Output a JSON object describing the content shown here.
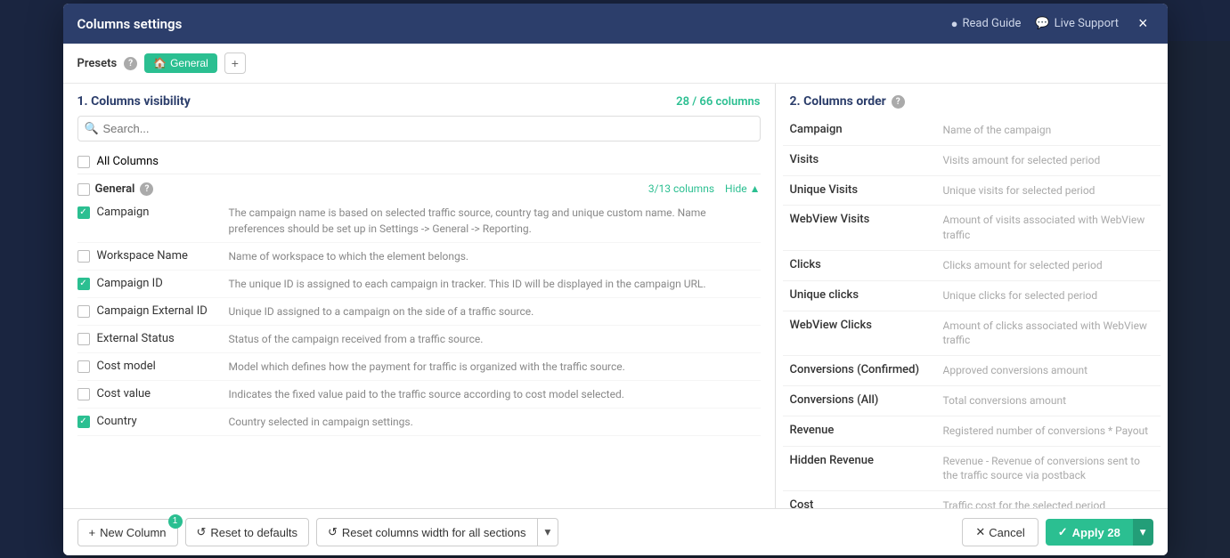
{
  "modal": {
    "title": "Columns settings",
    "close_label": "×"
  },
  "header_links": {
    "read_guide": "Read Guide",
    "live_support": "Live Support"
  },
  "presets": {
    "label": "Presets",
    "active": "General",
    "add_title": "+"
  },
  "left_panel": {
    "section_title": "1. Columns visibility",
    "columns_count": "28 / 66 columns",
    "search_placeholder": "Search...",
    "all_columns_label": "All Columns",
    "group": {
      "name": "General",
      "count": "3/13 columns",
      "hide_label": "Hide ▲"
    },
    "items": [
      {
        "label": "Campaign",
        "checked": true,
        "desc": "The campaign name is based on selected traffic source, country tag and unique custom name. Name preferences should be set up in Settings -> General -> Reporting."
      },
      {
        "label": "Workspace Name",
        "checked": false,
        "desc": "Name of workspace to which the element belongs."
      },
      {
        "label": "Campaign ID",
        "checked": true,
        "desc": "The unique ID is assigned to each campaign in tracker. This ID will be displayed in the campaign URL."
      },
      {
        "label": "Campaign External ID",
        "checked": false,
        "desc": "Unique ID assigned to a campaign on the side of a traffic source."
      },
      {
        "label": "External Status",
        "checked": false,
        "desc": "Status of the campaign received from a traffic source."
      },
      {
        "label": "Cost model",
        "checked": false,
        "desc": "Model which defines how the payment for traffic is organized with the traffic source."
      },
      {
        "label": "Cost value",
        "checked": false,
        "desc": "Indicates the fixed value paid to the traffic source according to cost model selected."
      },
      {
        "label": "Country",
        "checked": true,
        "desc": "Country selected in campaign settings."
      }
    ]
  },
  "right_panel": {
    "section_title": "2. Columns order",
    "items": [
      {
        "name": "Campaign",
        "desc": "Name of the campaign"
      },
      {
        "name": "Visits",
        "desc": "Visits amount for selected period"
      },
      {
        "name": "Unique Visits",
        "desc": "Unique visits for selected period"
      },
      {
        "name": "WebView Visits",
        "desc": "Amount of visits associated with WebView traffic"
      },
      {
        "name": "Clicks",
        "desc": "Clicks amount for selected period"
      },
      {
        "name": "Unique clicks",
        "desc": "Unique clicks for selected period"
      },
      {
        "name": "WebView Clicks",
        "desc": "Amount of clicks associated with WebView traffic"
      },
      {
        "name": "Conversions (Confirmed)",
        "desc": "Approved conversions amount"
      },
      {
        "name": "Conversions (All)",
        "desc": "Total conversions amount"
      },
      {
        "name": "Revenue",
        "desc": "Registered number of conversions * Payout"
      },
      {
        "name": "Hidden Revenue",
        "desc": "Revenue - Revenue of conversions sent to the traffic source via postback"
      },
      {
        "name": "Cost",
        "desc": "Traffic cost for the selected period"
      }
    ]
  },
  "footer": {
    "new_column_label": "New Column",
    "new_column_badge": "1",
    "reset_defaults_label": "Reset to defaults",
    "reset_width_label": "Reset columns width for all sections",
    "cancel_label": "Cancel",
    "apply_label": "Apply 28"
  }
}
